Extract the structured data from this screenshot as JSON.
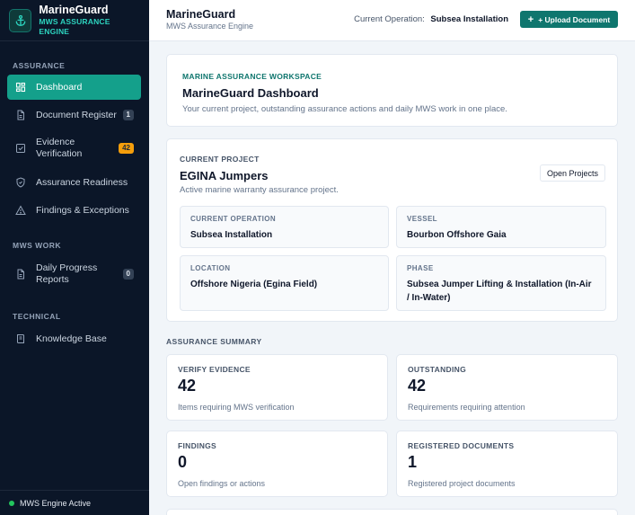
{
  "brand": {
    "name": "MarineGuard",
    "subtitle": "MWS ASSURANCE ENGINE"
  },
  "sidebar": {
    "sections": [
      {
        "label": "ASSURANCE"
      },
      {
        "label": "MWS WORK"
      },
      {
        "label": "TECHNICAL"
      }
    ],
    "items": [
      {
        "label": "Dashboard",
        "icon": "grid-icon",
        "active": true
      },
      {
        "label": "Document Register",
        "icon": "document-icon",
        "badge": "1"
      },
      {
        "label": "Evidence Verification",
        "icon": "checkbox-icon",
        "badge": "42"
      },
      {
        "label": "Assurance Readiness",
        "icon": "shield-icon"
      },
      {
        "label": "Findings & Exceptions",
        "icon": "warning-icon"
      },
      {
        "label": "Daily Progress Reports",
        "icon": "document-icon",
        "badge": "0"
      },
      {
        "label": "Knowledge Base",
        "icon": "book-icon"
      }
    ],
    "status": "MWS Engine Active"
  },
  "header": {
    "title": "MarineGuard",
    "subtitle": "MWS Assurance Engine",
    "operation_label": "Current Operation:",
    "operation_value": "Subsea Installation",
    "upload_label": "+ Upload Document"
  },
  "workspace": {
    "kicker": "MARINE ASSURANCE WORKSPACE",
    "title": "MarineGuard Dashboard",
    "description": "Your current project, outstanding assurance actions and daily MWS work in one place."
  },
  "project": {
    "kicker": "CURRENT PROJECT",
    "name": "EGINA Jumpers",
    "description": "Active marine warranty assurance project.",
    "open_label": "Open Projects",
    "fields": [
      {
        "label": "CURRENT OPERATION",
        "value": "Subsea Installation"
      },
      {
        "label": "VESSEL",
        "value": "Bourbon Offshore Gaia"
      },
      {
        "label": "LOCATION",
        "value": "Offshore Nigeria (Egina Field)"
      },
      {
        "label": "PHASE",
        "value": "Subsea Jumper Lifting & Installation (In-Air / In-Water)"
      }
    ]
  },
  "summary": {
    "label": "ASSURANCE SUMMARY",
    "stats": [
      {
        "label": "VERIFY EVIDENCE",
        "value": "42",
        "desc": "Items requiring MWS verification"
      },
      {
        "label": "OUTSTANDING",
        "value": "42",
        "desc": "Requirements requiring attention"
      },
      {
        "label": "FINDINGS",
        "value": "0",
        "desc": "Open findings or actions"
      },
      {
        "label": "REGISTERED DOCUMENTS",
        "value": "1",
        "desc": "Registered project documents"
      }
    ]
  },
  "colors": {
    "accent": "#14a08b",
    "sidebar": "#0b1628",
    "brand_sub": "#2dd4bf",
    "badge_amber": "#f59e0b",
    "status_green": "#22c55e"
  }
}
